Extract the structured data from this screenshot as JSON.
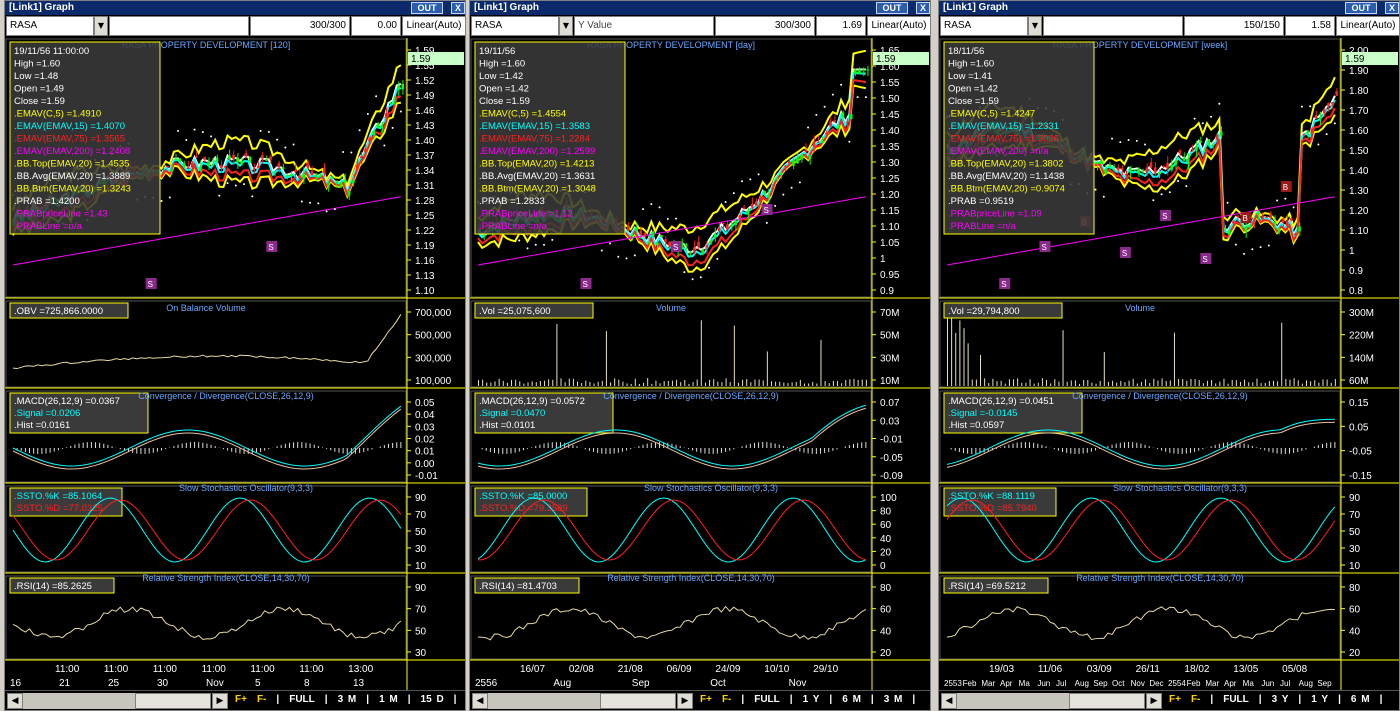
{
  "windows": [
    {
      "title": "[Link1] Graph",
      "buttons": [
        "T",
        "OUT",
        "X"
      ],
      "symbol": "RASA",
      "ylabel": "",
      "bars": "300/300",
      "value": "0.00",
      "scale": "Linear(Auto)",
      "chart_title": "RASA PROPERTY DEVELOPMENT [120]",
      "info": [
        {
          "t": "19/11/56 11:00:00",
          "c": "#ffffff"
        },
        {
          "t": "High  =1.60",
          "c": "#ffffff"
        },
        {
          "t": "Low  =1.48",
          "c": "#ffffff"
        },
        {
          "t": "Open  =1.49",
          "c": "#ffffff"
        },
        {
          "t": "Close  =1.59",
          "c": "#ffffff"
        },
        {
          "t": ".EMAV(C,5)  =1.4910",
          "c": "#ffff00"
        },
        {
          "t": ".EMAV(EMAV,15)  =1.4070",
          "c": "#00ffff"
        },
        {
          "t": ".EMAV(EMAV,75)  =1.3565",
          "c": "#ff2020"
        },
        {
          "t": ".EMAV(EMAV,200)  =1.2408",
          "c": "#ff00ff"
        },
        {
          "t": ".BB.Top(EMAV,20)  =1.4535",
          "c": "#ffff00"
        },
        {
          "t": ".BB.Avg(EMAV,20)  =1.3889",
          "c": "#ffffff"
        },
        {
          "t": ".BB.Btm(EMAV,20)  =1.3243",
          "c": "#ffff00"
        },
        {
          "t": ".PRAB  =1.4200",
          "c": "#ffffff"
        },
        {
          "t": ".PRABpriceLine  =1.43",
          "c": "#ff00ff"
        },
        {
          "t": ".PRABLine  =n/a",
          "c": "#ff00ff"
        }
      ],
      "price_tag": "1.59",
      "price_axis": [
        "1.59",
        "1.55",
        "1.52",
        "1.49",
        "1.46",
        "1.43",
        "1.40",
        "1.37",
        "1.34",
        "1.31",
        "1.28",
        "1.25",
        "1.22",
        "1.19",
        "1.16",
        "1.13",
        "1.10"
      ],
      "obv_label": ".OBV  =725,866.0000",
      "obv_title": "On Balance Volume",
      "obv_axis": [
        "700,000",
        "500,000",
        "300,000",
        "100,000"
      ],
      "macd_labels": [
        ".MACD(26,12,9)  =0.0367",
        ".Signal  =0.0206",
        ".Hist  =0.0161"
      ],
      "macd_title": "Convergence / Divergence(CLOSE,26,12,9)",
      "macd_axis": [
        "0.05",
        "0.04",
        "0.03",
        "0.02",
        "0.01",
        "0.00",
        "-0.01"
      ],
      "ssto_labels": [
        ".SSTO.%K  =85.1064",
        ".SSTO.%D  =77.0325"
      ],
      "ssto_title": "Slow Stochastics Oscillator(9,3,3)",
      "ssto_axis": [
        "90",
        "70",
        "50",
        "30",
        "10"
      ],
      "rsi_label": ".RSI(14)  =85.2625",
      "rsi_title": "Relative Strength Index(CLOSE,14,30,70)",
      "rsi_axis": [
        "90",
        "70",
        "50",
        "30"
      ],
      "x_top": [
        "11:00",
        "11:00",
        "11:00",
        "11:00",
        "11:00",
        "11:00",
        "13:00"
      ],
      "x_bottom": [
        "16",
        "21",
        "25",
        "30",
        "Nov",
        "5",
        "8",
        "13"
      ],
      "zoom": [
        "F+",
        "F-",
        "|",
        "FULL",
        "|",
        "3 M",
        "|",
        "1 M",
        "|",
        "15 D",
        "|"
      ],
      "markers": [
        "S",
        "S"
      ],
      "seed": 3,
      "trend": "up1"
    },
    {
      "title": "[Link1] Graph",
      "buttons": [
        "T",
        "OUT",
        "X"
      ],
      "symbol": "RASA",
      "ylabel": "Y Value",
      "bars": "300/300",
      "value": "1.69",
      "scale": "Linear(Auto)",
      "chart_title": "RASA PROPERTY DEVELOPMENT [day]",
      "info": [
        {
          "t": "19/11/56",
          "c": "#ffffff"
        },
        {
          "t": "High  =1.60",
          "c": "#ffffff"
        },
        {
          "t": "Low  =1.42",
          "c": "#ffffff"
        },
        {
          "t": "Open  =1.42",
          "c": "#ffffff"
        },
        {
          "t": "Close  =1.59",
          "c": "#ffffff"
        },
        {
          "t": ".EMAV(C,5)  =1.4554",
          "c": "#ffff00"
        },
        {
          "t": ".EMAV(EMAV,15)  =1.3583",
          "c": "#00ffff"
        },
        {
          "t": ".EMAV(EMAV,75)  =1.2284",
          "c": "#ff2020"
        },
        {
          "t": ".EMAV(EMAV,200)  =1.2599",
          "c": "#ff00ff"
        },
        {
          "t": ".BB.Top(EMAV,20)  =1.4213",
          "c": "#ffff00"
        },
        {
          "t": ".BB.Avg(EMAV,20)  =1.3631",
          "c": "#ffffff"
        },
        {
          "t": ".BB.Btm(EMAV,20)  =1.3048",
          "c": "#ffff00"
        },
        {
          "t": ".PRAB  =1.2833",
          "c": "#ffffff"
        },
        {
          "t": ".PRABpriceLine  =1.12",
          "c": "#ff00ff"
        },
        {
          "t": ".PRABLine  =n/a",
          "c": "#ff00ff"
        }
      ],
      "price_tag": "1.59",
      "price_axis": [
        "1.65",
        "1.60",
        "1.55",
        "1.50",
        "1.45",
        "1.40",
        "1.35",
        "1.30",
        "1.25",
        "1.20",
        "1.15",
        "1.10",
        "1.05",
        "1",
        "0.95",
        "0.9"
      ],
      "obv_label": ".Vol  =25,075,600",
      "obv_title": "Volume",
      "obv_axis": [
        "70M",
        "50M",
        "30M",
        "10M"
      ],
      "macd_labels": [
        ".MACD(26,12,9)  =0.0572",
        ".Signal  =0.0470",
        ".Hist  =0.0101"
      ],
      "macd_title": "Convergence / Divergence(CLOSE,26,12,9)",
      "macd_axis": [
        "0.07",
        "0.03",
        "-0.01",
        "-0.05",
        "-0.09"
      ],
      "ssto_labels": [
        ".SSTO.%K  =85.0000",
        ".SSTO.%D  =79.3589"
      ],
      "ssto_title": "Slow Stochastics Oscillator(9,3,3)",
      "ssto_axis": [
        "100",
        "80",
        "60",
        "40",
        "20",
        "0"
      ],
      "rsi_label": ".RSI(14)  =81.4703",
      "rsi_title": "Relative Strength Index(CLOSE,14,30,70)",
      "rsi_axis": [
        "80",
        "60",
        "40",
        "20"
      ],
      "x_top": [
        "16/07",
        "02/08",
        "21/08",
        "06/09",
        "24/09",
        "10/10",
        "29/10"
      ],
      "x_bottom": [
        "2556",
        "Aug",
        "Sep",
        "Oct",
        "Nov"
      ],
      "zoom": [
        "F+",
        "F-",
        "|",
        "FULL",
        "|",
        "1 Y",
        "|",
        "6 M",
        "|",
        "3 M",
        "|"
      ],
      "markers": [
        "S",
        "S",
        "S"
      ],
      "seed": 7,
      "trend": "up2"
    },
    {
      "title": "[Link1] Graph",
      "buttons": [
        "T",
        "OUT",
        "X"
      ],
      "symbol": "RASA",
      "ylabel": "",
      "bars": "150/150",
      "value": "1.58",
      "scale": "Linear(Auto)",
      "chart_title": "RASA PROPERTY DEVELOPMENT [week]",
      "info": [
        {
          "t": "18/11/56",
          "c": "#ffffff"
        },
        {
          "t": "High  =1.60",
          "c": "#ffffff"
        },
        {
          "t": "Low  =1.41",
          "c": "#ffffff"
        },
        {
          "t": "Open  =1.42",
          "c": "#ffffff"
        },
        {
          "t": "Close  =1.59",
          "c": "#ffffff"
        },
        {
          "t": ".EMAV(C,5)  =1.4247",
          "c": "#ffff00"
        },
        {
          "t": ".EMAV(EMAV,15)  =1.2331",
          "c": "#00ffff"
        },
        {
          "t": ".EMAV(EMAV,75)  =1.3026",
          "c": "#ff2020"
        },
        {
          "t": ".EMAV(EMAV,200)  =n/a",
          "c": "#ff00ff"
        },
        {
          "t": ".BB.Top(EMAV,20)  =1.3802",
          "c": "#ffff00"
        },
        {
          "t": ".BB.Avg(EMAV,20)  =1.1438",
          "c": "#ffffff"
        },
        {
          "t": ".BB.Btm(EMAV,20)  =0.9074",
          "c": "#ffff00"
        },
        {
          "t": ".PRAB  =0.9519",
          "c": "#ffffff"
        },
        {
          "t": ".PRABpriceLine  =1.09",
          "c": "#ff00ff"
        },
        {
          "t": ".PRABLine  =n/a",
          "c": "#ff00ff"
        }
      ],
      "price_tag": "1.59",
      "price_axis": [
        "2.00",
        "1.90",
        "1.80",
        "1.70",
        "1.60",
        "1.50",
        "1.40",
        "1.30",
        "1.20",
        "1.10",
        "1",
        "0.9",
        "0.8"
      ],
      "obv_label": ".Vol  =29,794,800",
      "obv_title": "Volume",
      "obv_axis": [
        "300M",
        "220M",
        "140M",
        "60M"
      ],
      "macd_labels": [
        ".MACD(26,12,9)  =0.0451",
        ".Signal  =-0.0145",
        ".Hist  =0.0597"
      ],
      "macd_title": "Convergence / Divergence(CLOSE,26,12,9)",
      "macd_axis": [
        "0.15",
        "0.05",
        "-0.05",
        "-0.15"
      ],
      "ssto_labels": [
        ".SSTO.%K  =88.1119",
        ".SSTO.%D  =85.7940"
      ],
      "ssto_title": "Slow Stochastics Oscillator(9,3,3)",
      "ssto_axis": [
        "90",
        "70",
        "50",
        "30",
        "10"
      ],
      "rsi_label": ".RSI(14)  =69.5212",
      "rsi_title": "Relative Strength Index(CLOSE,14,30,70)",
      "rsi_axis": [
        "80",
        "60",
        "40",
        "20"
      ],
      "x_top": [
        "19/03",
        "11/06",
        "03/09",
        "26/11",
        "18/02",
        "13/05",
        "05/08"
      ],
      "x_bottom": [
        "2553",
        "Feb",
        "Mar",
        "Apr",
        "Ma",
        "Jun",
        "Jul",
        "Aug",
        "Sep",
        "Oct",
        "Nov",
        "Dec",
        "2554",
        "Feb",
        "Mar",
        "Apr",
        "Ma",
        "Jun",
        "Jul",
        "Aug",
        "Sep"
      ],
      "zoom": [
        "F+",
        "F-",
        "|",
        "FULL",
        "|",
        "3 Y",
        "|",
        "1 Y",
        "|",
        "6 M",
        "|"
      ],
      "markers": [
        "S",
        "S",
        "B",
        "S",
        "S",
        "S",
        "B",
        "B"
      ],
      "seed": 11,
      "trend": "wave"
    }
  ]
}
